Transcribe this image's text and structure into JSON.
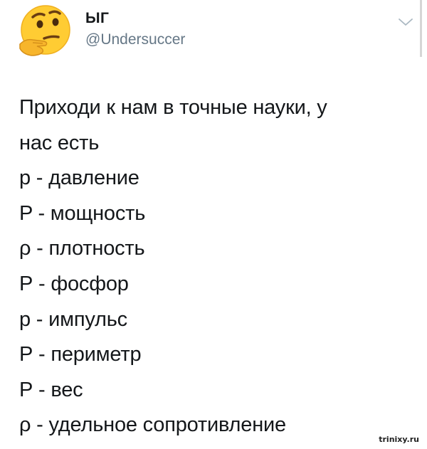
{
  "tweet": {
    "author": {
      "display_name": "ЫГ",
      "handle": "@Undersuccer",
      "avatar": "thinking-face-emoji"
    },
    "menu_icon": "chevron-down-icon",
    "text_lines": [
      "Приходи к нам в точные науки, у",
      "нас есть",
      "p - давление",
      "P - мощность",
      "ρ - плотность",
      "Р - фосфор",
      "р - импульс",
      "Р - периметр",
      "Р - вес",
      "ρ - удельное сопротивление"
    ]
  },
  "watermark": "trinixy.ru",
  "colors": {
    "text": "#14171a",
    "secondary_text": "#657786",
    "emoji_yellow": "#ffcc33"
  }
}
